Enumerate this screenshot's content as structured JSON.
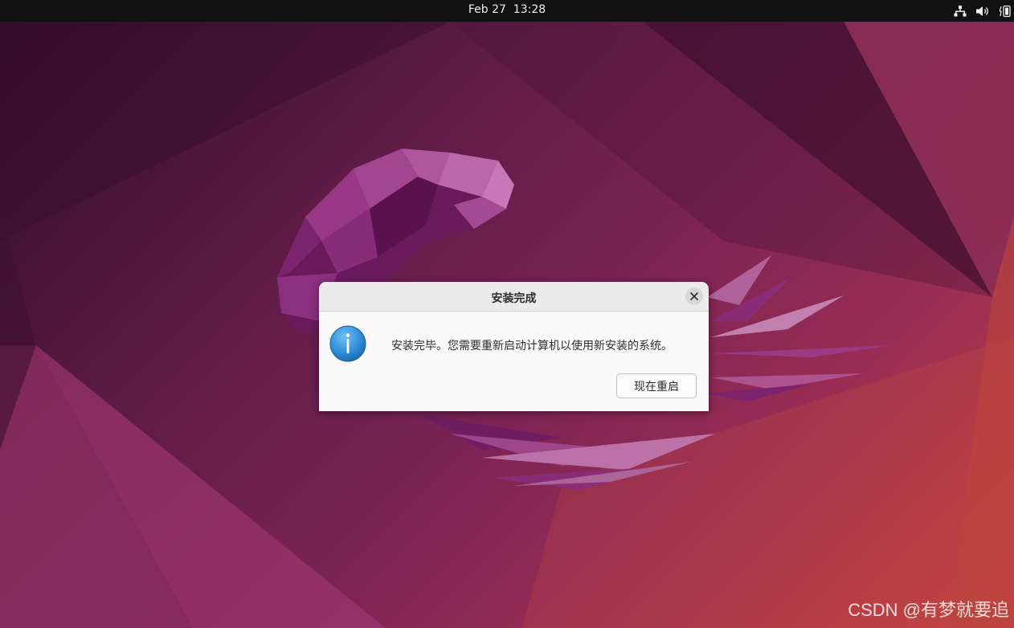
{
  "topbar": {
    "clock": "Feb 27  13:28",
    "tray_icons": [
      "network-icon",
      "volume-icon",
      "battery-icon"
    ]
  },
  "dialog": {
    "title": "安装完成",
    "message": "安装完毕。您需要重新启动计算机以使用新安装的系统。",
    "restart_button_label": "现在重启",
    "icon": "info-icon",
    "close_icon": "close-icon"
  },
  "watermark": {
    "text": "CSDN @有梦就要追"
  },
  "colors": {
    "topbar_bg": "#111111",
    "dialog_bg": "#fafafa",
    "dialog_header_bg": "#ebebeb",
    "info_blue": "#2f8fd8"
  }
}
